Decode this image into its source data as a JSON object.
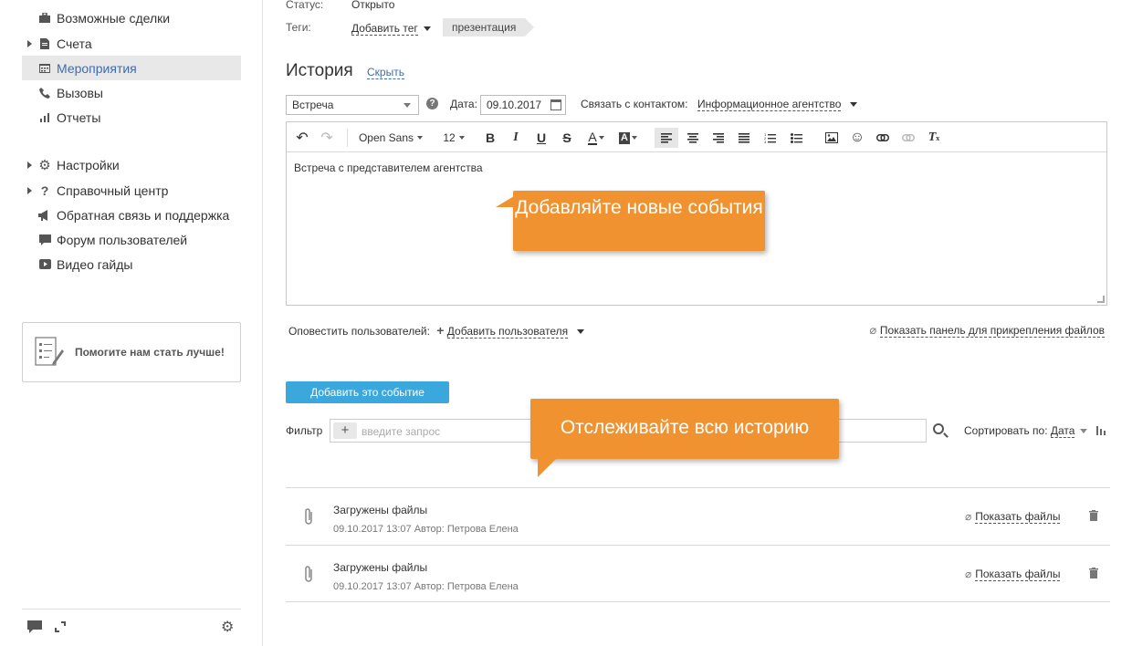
{
  "sidebar": {
    "items": [
      {
        "label": "Возможные сделки",
        "icon": "briefcase-icon"
      },
      {
        "label": "Счета",
        "icon": "document-icon"
      },
      {
        "label": "Мероприятия",
        "icon": "calendar-icon"
      },
      {
        "label": "Вызовы",
        "icon": "phone-icon"
      },
      {
        "label": "Отчеты",
        "icon": "bar-chart-icon"
      },
      {
        "label": "Настройки",
        "icon": "gear-icon"
      },
      {
        "label": "Справочный центр",
        "icon": "question-icon"
      },
      {
        "label": "Обратная связь и поддержка",
        "icon": "megaphone-icon"
      },
      {
        "label": "Форум пользователей",
        "icon": "chat-icon"
      },
      {
        "label": "Видео гайды",
        "icon": "video-icon"
      }
    ],
    "help_box": "Помогите нам стать лучше!"
  },
  "header": {
    "status_label": "Статус:",
    "status_value": "Открыто",
    "tags_label": "Теги:",
    "add_tag": "Добавить тег",
    "tag": "презентация"
  },
  "history": {
    "title": "История",
    "hide": "Скрыть",
    "event_type": "Встреча",
    "date_label": "Дата:",
    "date_value": "09.10.2017",
    "contact_label": "Связать с контактом:",
    "contact_value": "Информационное агентство"
  },
  "editor": {
    "font": "Open Sans",
    "size": "12",
    "content": "Встреча с представителем агентства"
  },
  "tooltips": {
    "add_events": "Добавляйте новые события",
    "track_history": "Отслеживайте всю историю"
  },
  "notify": {
    "label": "Оповестить пользователей:",
    "add_user": "Добавить пользователя",
    "attach_panel": "Показать панель для прикрепления файлов"
  },
  "add_button": "Добавить это событие",
  "filter": {
    "label": "Фильтр",
    "placeholder": "введите запрос",
    "sort_label": "Сортировать по:",
    "sort_value": "Дата"
  },
  "entries": [
    {
      "title": "Загружены файлы",
      "meta": "09.10.2017 13:07 Автор: Петрова Елена",
      "action": "Показать файлы"
    },
    {
      "title": "Загружены файлы",
      "meta": "09.10.2017 13:07 Автор: Петрова Елена",
      "action": "Показать файлы"
    }
  ],
  "colors": {
    "accent": "#3d6cb3",
    "button": "#3aa7dd",
    "tooltip": "#f0922f"
  }
}
